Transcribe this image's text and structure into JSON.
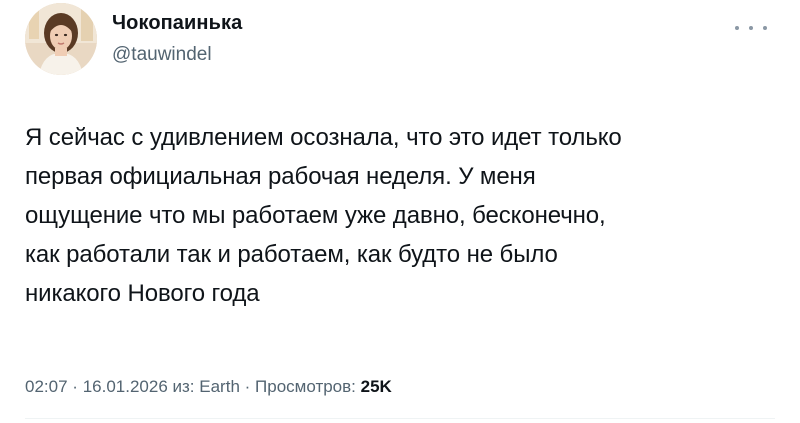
{
  "author": {
    "name": "Чокопаинька",
    "handle": "@tauwindel",
    "avatar_icon": "user-avatar-photo"
  },
  "more_icon": "more-dots-icon",
  "tweet": {
    "text": "Я сейчас с удивлением осознала, что это идет только\nпервая официальная рабочая неделя. У меня\nощущение что мы работаем уже давно, бесконечно,\nкак работали так и работаем, как будто не было\nникакого Нового года"
  },
  "meta": {
    "time": "02:07",
    "separator": "·",
    "date": "16.01.2026",
    "source_prefix": "из:",
    "source": "Earth",
    "views_label": "Просмотров:",
    "views_count": "25K"
  },
  "colors": {
    "text_primary": "#0f1419",
    "text_secondary": "#536471",
    "divider": "#eff3f4"
  }
}
